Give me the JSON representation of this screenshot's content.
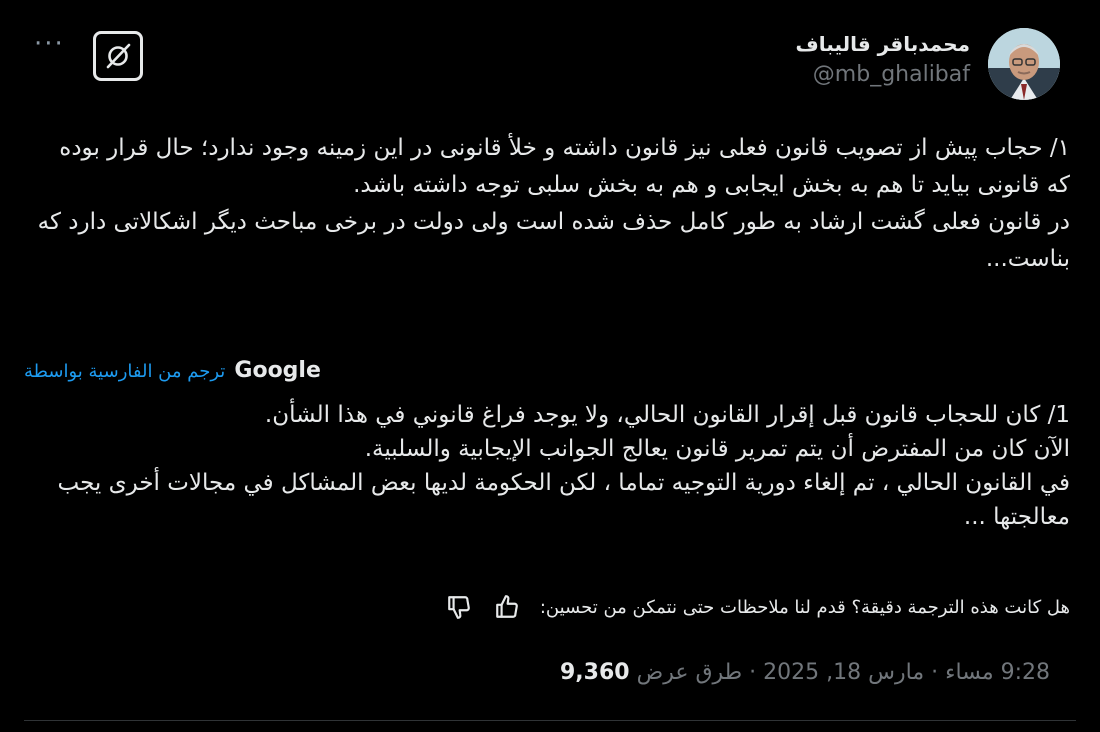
{
  "author": {
    "display_name": "محمدباقر قالیباف",
    "handle": "@mb_ghalibaf"
  },
  "tweet": {
    "text": "۱/ حجاب پیش از تصویب قانون فعلی نیز قانون داشته و خلأ قانونی در این زمینه وجود ندارد؛ حال قرار بوده که قانونی بیاید تا هم به بخش ایجابی و هم به بخش سلبی توجه داشته باشد.\nدر قانون فعلی گشت ارشاد به طور کامل حذف شده است ولی دولت در برخی مباحث دیگر اشکالاتی دارد که بناست..."
  },
  "translation": {
    "provider": "Google",
    "via_label": "ترجم من الفارسية بواسطة",
    "text": "1/ كان للحجاب قانون قبل إقرار القانون الحالي، ولا يوجد فراغ قانوني في هذا الشأن.\nالآن كان من المفترض أن يتم تمرير قانون يعالج الجوانب الإيجابية والسلبية.\nفي القانون الحالي ، تم إلغاء دورية التوجيه تماما ، لكن الحكومة لديها بعض المشاكل في مجالات أخرى يجب معالجتها ...",
    "feedback_question": "هل كانت هذه الترجمة دقيقة؟ قدم لنا ملاحظات حتى نتمكن من تحسين:"
  },
  "meta": {
    "time": "9:28 مساء",
    "date": "مارس 18, 2025",
    "views_label": "طرق عرض",
    "views_count": "9,360",
    "separator": "·"
  },
  "icons": {
    "more": "more-options-icon",
    "grok": "grok-icon",
    "thumbs_up": "thumbs-up-icon",
    "thumbs_down": "thumbs-down-icon"
  },
  "colors": {
    "background": "#000000",
    "text": "#e7e9ea",
    "muted": "#71767b",
    "link": "#1d9bf0"
  }
}
